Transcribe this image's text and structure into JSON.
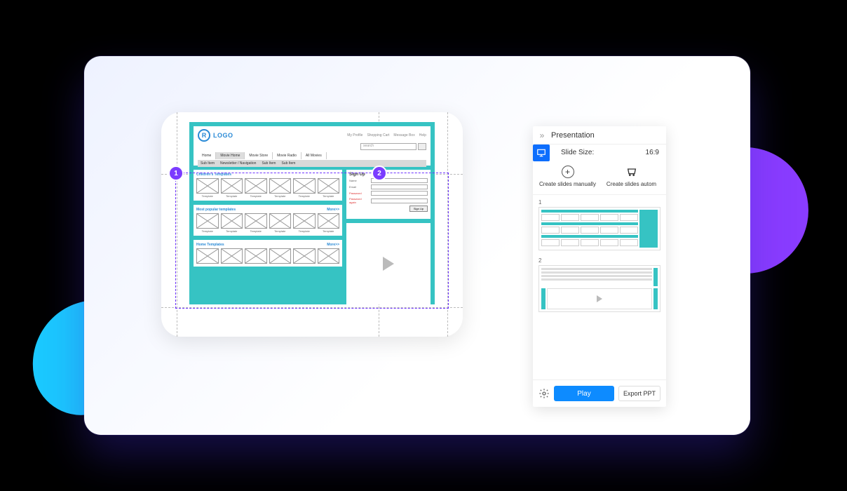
{
  "panel": {
    "title": "Presentation",
    "slideSizeLabel": "Slide Size:",
    "slideSizeValue": "16:9",
    "createManual": "Create slides manually",
    "createAuto": "Create slides autom",
    "slides": [
      "1",
      "2"
    ],
    "playLabel": "Play",
    "exportLabel": "Export PPT"
  },
  "mock": {
    "logoR": "R",
    "logoText": "LOGO",
    "topLinks": [
      "My Profile",
      "Shopping Cart",
      "Message Box",
      "Help"
    ],
    "searchPlaceholder": "search",
    "nav": [
      "Home",
      "Movie Home",
      "Movie Store",
      "Movie Radio",
      "All Movies"
    ],
    "navActiveIndex": 1,
    "subnav": [
      "Sub Item",
      "Newsletter / Navigation",
      "Sub Item",
      "Sub Item"
    ],
    "sections": [
      {
        "title": "Children's Templates",
        "more": "",
        "caption": "Template"
      },
      {
        "title": "Most popular templates",
        "more": "More>>",
        "caption": "Template"
      },
      {
        "title": "Home Templates",
        "more": "More>>",
        "caption": "Template"
      }
    ],
    "signup": {
      "title": "Sign Up",
      "fields": [
        "Name",
        "Email",
        "Password",
        "Password again"
      ],
      "button": "Sign Up"
    }
  },
  "badges": {
    "one": "1",
    "two": "2"
  }
}
